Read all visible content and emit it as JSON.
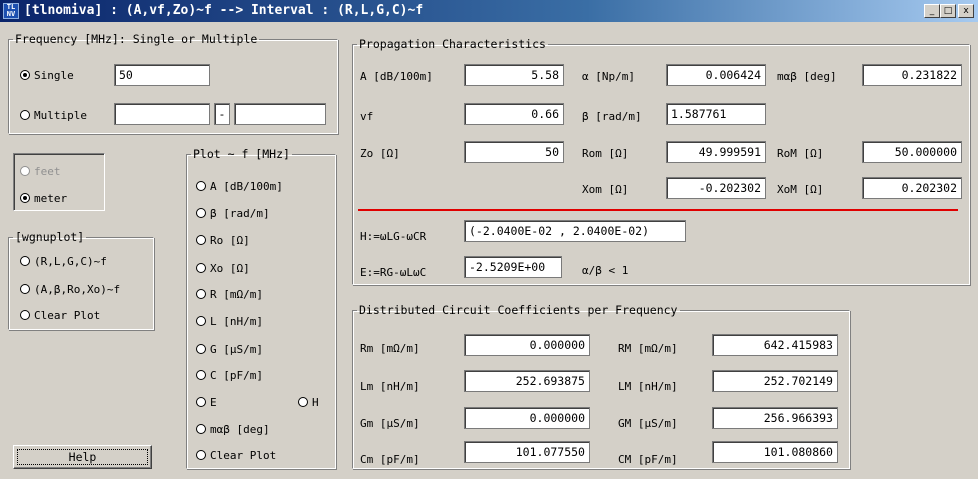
{
  "window": {
    "icon_text": "TL NV",
    "title": "[tlnomiva] : (A,vf,Zo)~f --> Interval : (R,L,G,C)~f",
    "minimize_label": "_",
    "maximize_label": "□",
    "close_label": "x"
  },
  "frequency": {
    "legend": "Frequency [MHz]: Single or Multiple",
    "single_label": "Single",
    "single_value": "50",
    "multiple_label": "Multiple",
    "multiple_from": "",
    "dash": "-",
    "multiple_to": "",
    "selected": "single"
  },
  "units": {
    "feet_label": "feet",
    "meter_label": "meter",
    "selected": "meter"
  },
  "wgnuplot": {
    "legend": "[wgnuplot]",
    "items": [
      "(R,L,G,C)~f",
      "(A,β,Ro,Xo)~f",
      "Clear Plot"
    ]
  },
  "help_label": "Help",
  "plot": {
    "legend": "Plot ~ f [MHz]",
    "items": [
      "A [dB/100m]",
      "β [rad/m]",
      "Ro [Ω]",
      "Xo [Ω]",
      "R [mΩ/m]",
      "L [nH/m]",
      "G [µS/m]",
      "C [pF/m]"
    ],
    "e_label": "E",
    "h_label": "H",
    "mab_label": "mαβ [deg]",
    "clear_label": "Clear Plot"
  },
  "propagation": {
    "legend": "Propagation Characteristics",
    "a_label": "A [dB/100m]",
    "a_value": "5.58",
    "alpha_label": "α [Np/m]",
    "alpha_value": "0.006424",
    "mab_label": "mαβ [deg]",
    "mab_value": "0.231822",
    "vf_label": "vf",
    "vf_value": "0.66",
    "beta_label": "β [rad/m]",
    "beta_value": "1.587761",
    "zo_label": "Zo [Ω]",
    "zo_value": "50",
    "rom_label": "Rom [Ω]",
    "rom_value": "49.999591",
    "roM_label": "RoM [Ω]",
    "roM_value": "50.000000",
    "xom_label": "Xom [Ω]",
    "xom_value": "-0.202302",
    "xoM_label": "XoM [Ω]",
    "xoM_value": "0.202302",
    "h_label": "H:=ωLG-ωCR",
    "h_value": "(-2.0400E-02 , 2.0400E-02)",
    "e_label": "E:=RG-ωLωC",
    "e_value": "-2.5209E+00",
    "ratio_label": "α/β < 1"
  },
  "distributed": {
    "legend": "Distributed Circuit Coefficients per Frequency",
    "rm_label": "Rm [mΩ/m]",
    "rm_value": "0.000000",
    "RM_label": "RM [mΩ/m]",
    "RM_value": "642.415983",
    "lm_label": "Lm [nH/m]",
    "lm_value": "252.693875",
    "LM_label": "LM [nH/m]",
    "LM_value": "252.702149",
    "gm_label": "Gm [µS/m]",
    "gm_value": "0.000000",
    "GM_label": "GM [µS/m]",
    "GM_value": "256.966393",
    "cm_label": "Cm [pF/m]",
    "cm_value": "101.077550",
    "CM_label": "CM [pF/m]",
    "CM_value": "101.080860"
  }
}
